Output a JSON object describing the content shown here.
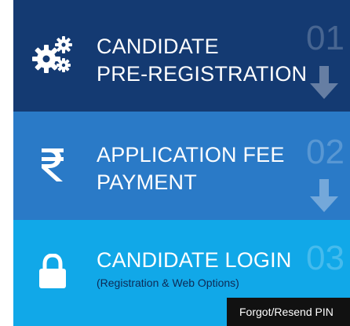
{
  "steps": [
    {
      "icon": "gears-icon",
      "title_line1": "CANDIDATE",
      "title_line2": "PRE-REGISTRATION",
      "number": "01",
      "arrow": "down-arrow-icon"
    },
    {
      "icon": "rupee-icon",
      "title_line1": "APPLICATION FEE",
      "title_line2": "PAYMENT",
      "number": "02",
      "arrow": "down-arrow-icon"
    },
    {
      "icon": "lock-icon",
      "title_line1": "CANDIDATE LOGIN",
      "subtitle": "(Registration & Web Options)",
      "number": "03"
    }
  ],
  "forgot_button": {
    "label": "Forgot/Resend PIN"
  },
  "colors": {
    "step1_bg": "#143a72",
    "step2_bg": "#2a7ac7",
    "step3_bg": "#11a8e8"
  }
}
